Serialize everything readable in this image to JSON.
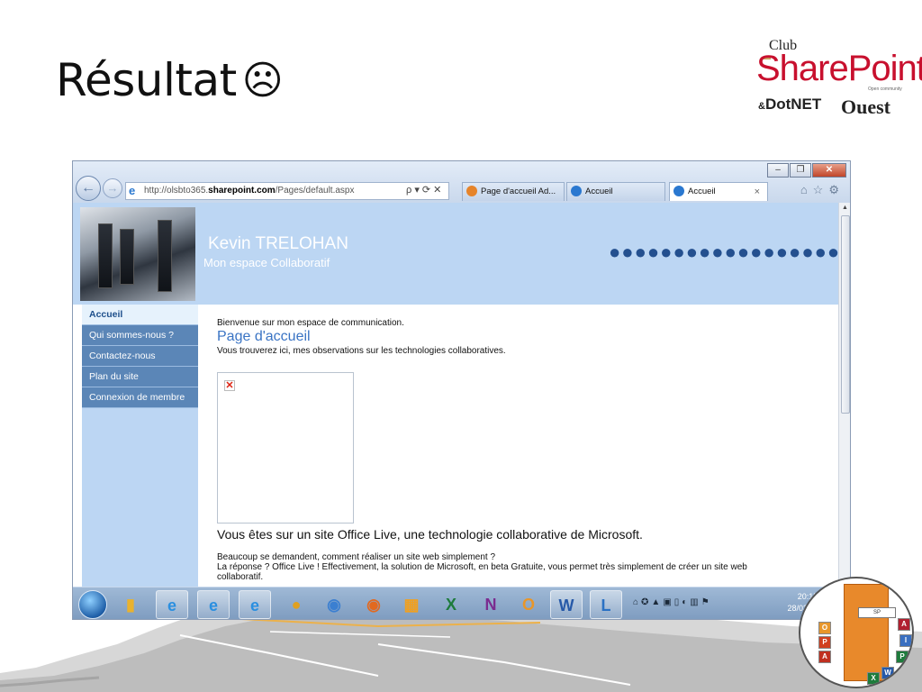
{
  "slide": {
    "title": "Résultat",
    "title_face": "☹"
  },
  "logo": {
    "club": "Club",
    "sharepoint": "SharePoint",
    "dotnet": "DotNET",
    "ampersand": "&",
    "ouest": "Ouest",
    "tagline": "Open community"
  },
  "browser": {
    "address_prefix": "http://olsbto365.",
    "address_host": "sharepoint.com",
    "address_path": "/Pages/default.aspx",
    "address_tools": "ρ ▾ ⟳ ✕",
    "tabs": [
      {
        "label": "Page d'accueil Ad...",
        "icon_color": "#e6842a"
      },
      {
        "label": "Accueil",
        "icon_color": "#2a78d0"
      },
      {
        "label": "Accueil",
        "icon_color": "#2a78d0",
        "active": true
      }
    ],
    "tab_close": "×",
    "toolbar_icons": "⌂☆⚙",
    "window_buttons": {
      "minimize": "–",
      "maximize": "❐",
      "close": "✕"
    }
  },
  "site": {
    "owner_name": "Kevin TRELOHAN",
    "owner_subtitle": "Mon espace Collaboratif",
    "dots": "●●●●●●●●●●●●●●●●●●",
    "nav": [
      {
        "label": "Accueil",
        "active": true
      },
      {
        "label": "Qui sommes-nous ?"
      },
      {
        "label": "Contactez-nous"
      },
      {
        "label": "Plan du site"
      },
      {
        "label": "Connexion de membre"
      }
    ],
    "welcome": "Bienvenue sur mon espace de communication.",
    "page_heading": "Page d'accueil",
    "description": "Vous trouverez ici, mes observations sur les technologies collaboratives.",
    "broken_image": "✕",
    "live_text": "Vous êtes sur un site Office Live, une technologie collaborative de Microsoft.",
    "paragraph_line1": "Beaucoup se demandent, comment réaliser un site web simplement ?",
    "paragraph_line2": "La réponse ? Office Live ! Effectivement, la solution de Microsoft, en beta Gratuite, vous permet très simplement de créer un site web",
    "paragraph_line3": "collaboratif."
  },
  "taskbar": {
    "apps": [
      {
        "name": "explorer",
        "glyph": "▮",
        "color": "#e9b22e"
      },
      {
        "name": "ie",
        "glyph": "e",
        "color": "#2a8fe0",
        "open": true
      },
      {
        "name": "ie",
        "glyph": "e",
        "color": "#2a8fe0",
        "open": true
      },
      {
        "name": "ie",
        "glyph": "e",
        "color": "#2a8fe0",
        "open": true
      },
      {
        "name": "chrome",
        "glyph": "●",
        "color": "#e0a020"
      },
      {
        "name": "media",
        "glyph": "◉",
        "color": "#3b7fd1"
      },
      {
        "name": "firefox",
        "glyph": "◉",
        "color": "#e2691f"
      },
      {
        "name": "app",
        "glyph": "▦",
        "color": "#f0a020"
      },
      {
        "name": "excel",
        "glyph": "X",
        "color": "#1e7b3c"
      },
      {
        "name": "onenote",
        "glyph": "N",
        "color": "#7b2c8f"
      },
      {
        "name": "outlook",
        "glyph": "O",
        "color": "#e8962a"
      },
      {
        "name": "word",
        "glyph": "W",
        "color": "#2659a8",
        "open": true
      },
      {
        "name": "lync",
        "glyph": "L",
        "color": "#2a71c4",
        "open": true
      }
    ],
    "tray_icons": "⌂✪▲▣▯◐▥⚑",
    "time": "20:15",
    "date": "28/03/2012"
  }
}
